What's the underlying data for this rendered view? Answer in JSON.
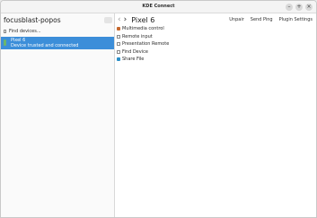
{
  "window": {
    "title": "KDE Connect",
    "controls": [
      "–",
      "+",
      "×"
    ]
  },
  "sidebar": {
    "hostname": "focusblast-popos",
    "find_devices_label": "Find devices...",
    "device": {
      "name": "Pixel 6",
      "status": "Device trusted and connected"
    }
  },
  "main": {
    "back_icon": "chevron-left-icon",
    "forward_icon": "chevron-right-icon",
    "back_glyph": "‹",
    "forward_glyph": "›",
    "title": "Pixel 6",
    "actions": [
      "Unpair",
      "Send Ping",
      "Plugin Settings"
    ],
    "plugins": [
      {
        "label": "Multimedia control",
        "icon": "media-icon"
      },
      {
        "label": "Remote input",
        "icon": "document-icon"
      },
      {
        "label": "Presentation Remote",
        "icon": "document-icon"
      },
      {
        "label": "Find Device",
        "icon": "document-icon"
      },
      {
        "label": "Share File",
        "icon": "folder-icon"
      }
    ]
  }
}
